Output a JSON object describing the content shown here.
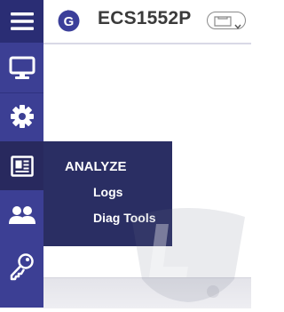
{
  "header": {
    "device_name": "ECS1552P"
  },
  "sidebar": {
    "items": [
      {
        "name": "menu",
        "icon": "hamburger-menu-icon"
      },
      {
        "name": "monitor",
        "icon": "monitor-icon"
      },
      {
        "name": "settings",
        "icon": "gear-icon"
      },
      {
        "name": "analyze",
        "icon": "document-icon",
        "active": true
      },
      {
        "name": "users",
        "icon": "users-icon"
      },
      {
        "name": "security",
        "icon": "key-icon"
      }
    ]
  },
  "flyout": {
    "title": "ANALYZE",
    "items": [
      {
        "label": "Logs"
      },
      {
        "label": "Diag Tools"
      }
    ]
  },
  "colors": {
    "rail": "#3c3f94",
    "rail_active": "#28295e",
    "flyout": "#2a2e63",
    "logo": "#3b3f9a"
  }
}
